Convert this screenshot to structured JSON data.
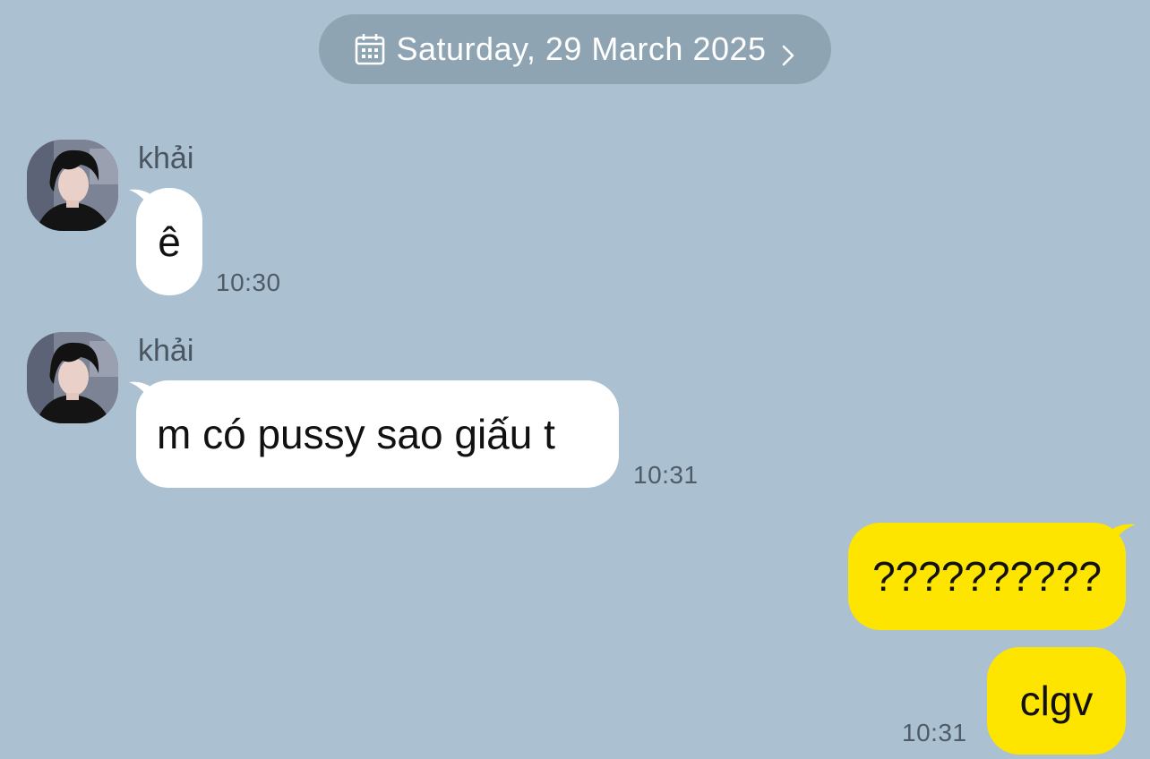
{
  "date_divider": {
    "label": "Saturday, 29 March 2025",
    "icon": "calendar-icon",
    "chevron": "chevron-right-icon"
  },
  "colors": {
    "background": "#abc1d1",
    "date_pill": "#8fa4b3",
    "incoming_bubble": "#ffffff",
    "outgoing_bubble": "#fee500"
  },
  "messages": [
    {
      "direction": "incoming",
      "sender": "khải",
      "text": "ê",
      "time": "10:30"
    },
    {
      "direction": "incoming",
      "sender": "khải",
      "text": "m có pussy sao giấu t",
      "time": "10:31"
    },
    {
      "direction": "outgoing",
      "text": "??????????",
      "time": ""
    },
    {
      "direction": "outgoing",
      "text": "clgv",
      "time": "10:31"
    }
  ]
}
